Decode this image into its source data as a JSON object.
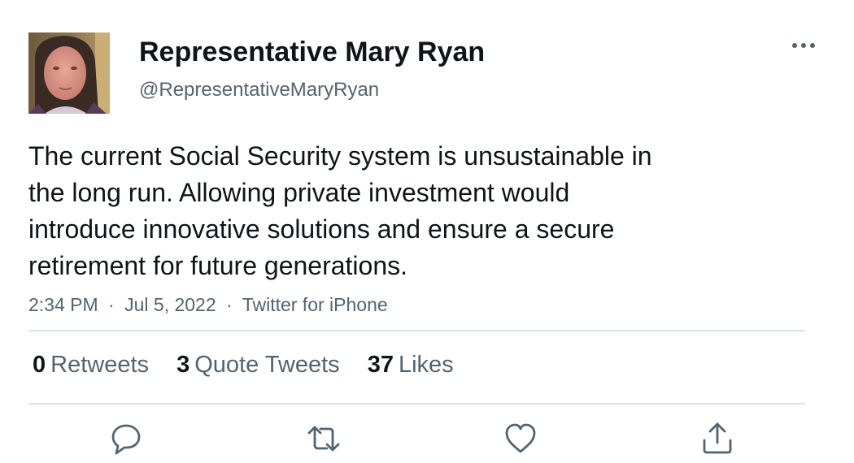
{
  "author": {
    "display_name": "Representative Mary Ryan",
    "handle": "@RepresentativeMaryRyan"
  },
  "tweet": {
    "text_lines": [
      "The current Social Security system is unsustainable in",
      "the long run. Allowing private investment would",
      "introduce innovative solutions and ensure a secure",
      "retirement for future generations."
    ],
    "time": "2:34 PM",
    "date": "Jul 5, 2022",
    "source": "Twitter for iPhone",
    "separator": "·"
  },
  "stats": {
    "retweets": {
      "count": "0",
      "label": "Retweets"
    },
    "quote_tweets": {
      "count": "3",
      "label": "Quote Tweets"
    },
    "likes": {
      "count": "37",
      "label": "Likes"
    }
  },
  "actions": [
    {
      "icon": "reply-icon"
    },
    {
      "icon": "retweet-icon"
    },
    {
      "icon": "like-icon"
    },
    {
      "icon": "share-icon"
    }
  ],
  "colors": {
    "text_primary": "#0f1419",
    "text_secondary": "#536471",
    "divider": "#dbe1e5",
    "icon": "#536471"
  }
}
